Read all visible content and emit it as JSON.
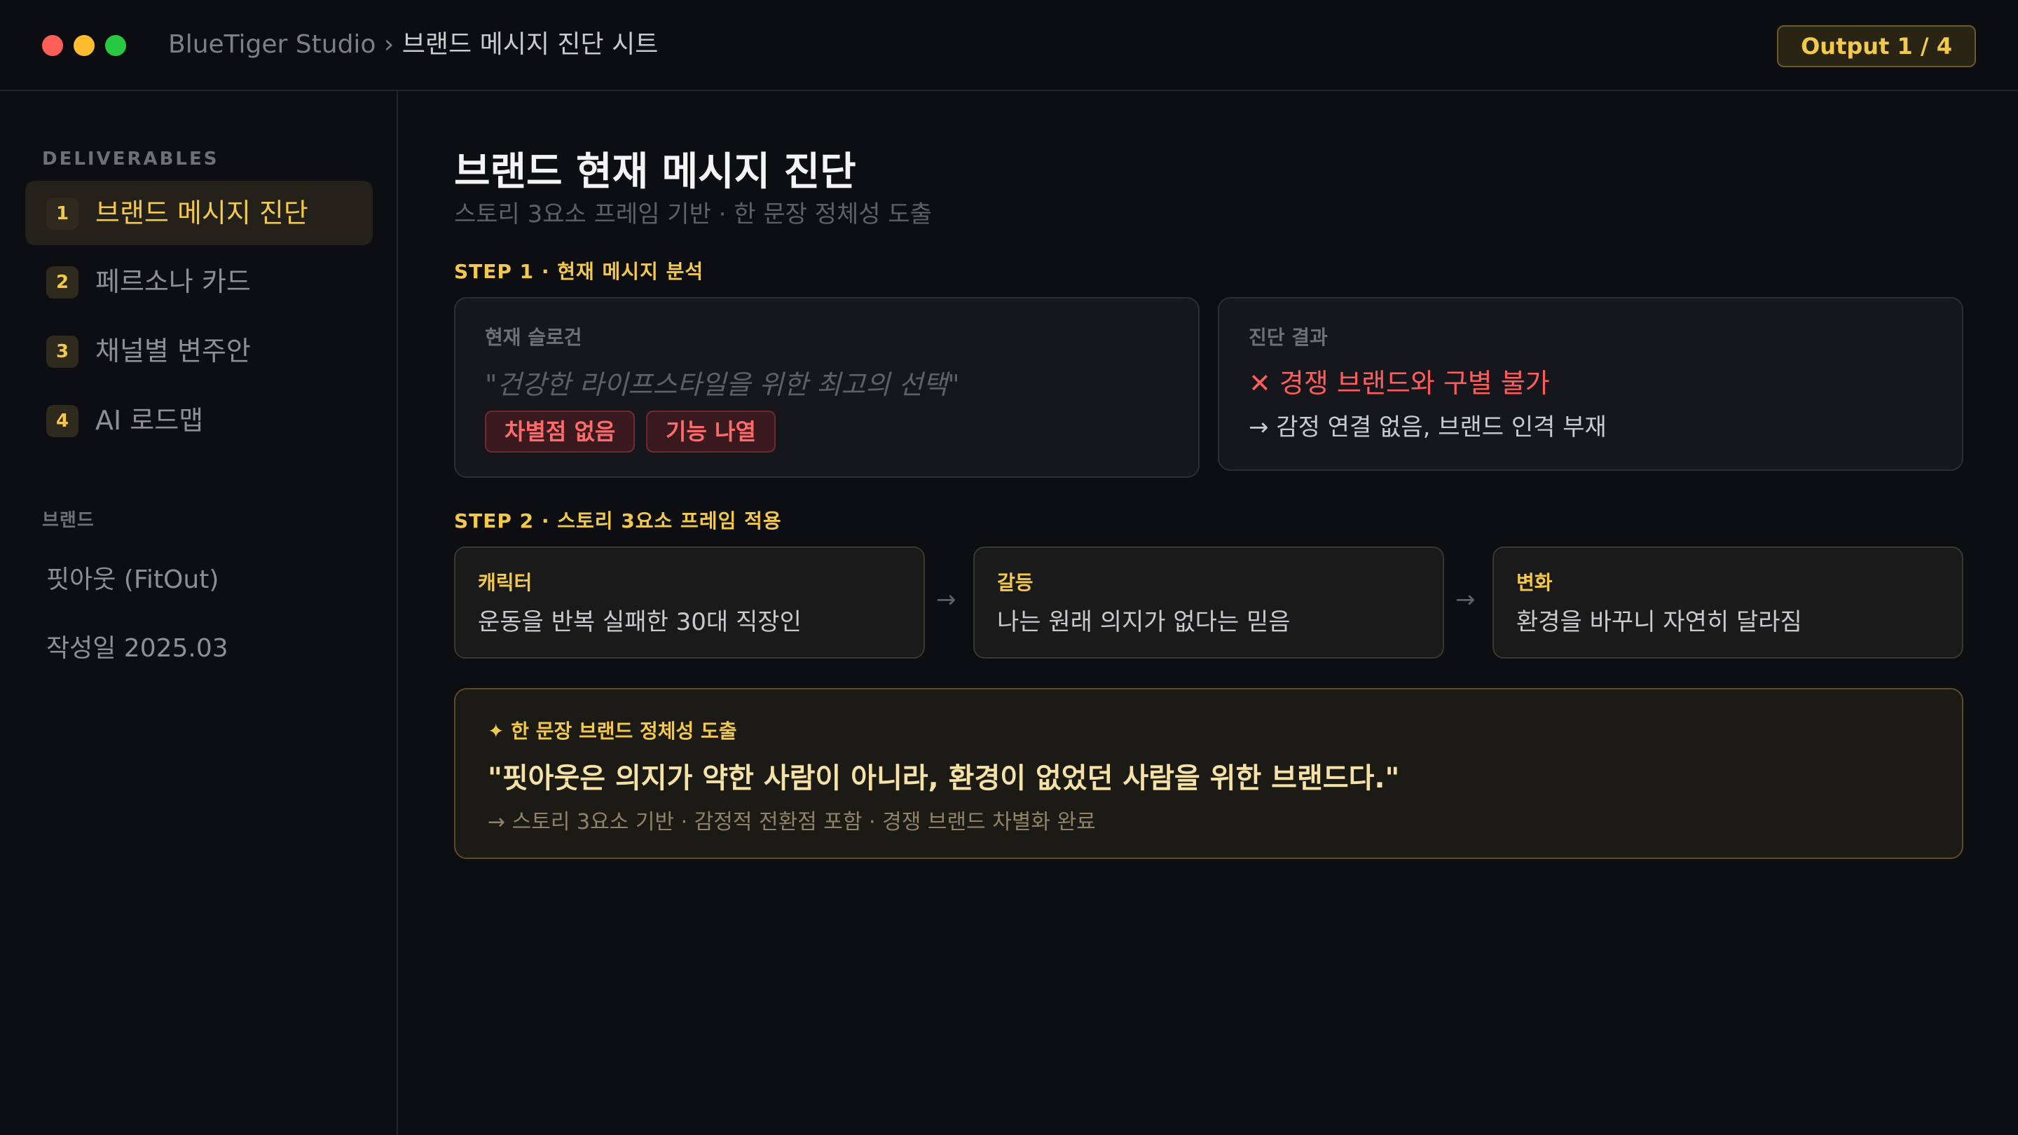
{
  "window": {
    "breadcrumb_root": "BlueTiger Studio",
    "breadcrumb_sep": "›",
    "breadcrumb_current": "브랜드 메시지 진단 시트",
    "output_badge": "Output 1 / 4"
  },
  "sidebar": {
    "section_label": "DELIVERABLES",
    "items": [
      {
        "num": "1",
        "label": "브랜드 메시지 진단"
      },
      {
        "num": "2",
        "label": "페르소나 카드"
      },
      {
        "num": "3",
        "label": "채널별 변주안"
      },
      {
        "num": "4",
        "label": "AI 로드맵"
      }
    ],
    "brand_label": "브랜드",
    "brand_name": "핏아웃 (FitOut)",
    "written_date": "작성일 2025.03"
  },
  "main": {
    "title": "브랜드 현재 메시지 진단",
    "subtitle": "스토리 3요소 프레임 기반 · 한 문장 정체성 도출",
    "step1": {
      "label": "STEP 1 · 현재 메시지 분석",
      "slogan_card": {
        "label": "현재 슬로건",
        "slogan": "\"건강한 라이프스타일을 위한 최고의 선택\"",
        "tags": [
          "차별점 없음",
          "기능 나열"
        ]
      },
      "result_card": {
        "label": "진단 결과",
        "verdict": "✕ 경쟁 브랜드와 구별 불가",
        "detail": "→ 감정 연결 없음, 브랜드 인격 부재"
      }
    },
    "step2": {
      "label": "STEP 2 · 스토리 3요소 프레임 적용",
      "arrow": "→",
      "frames": [
        {
          "key": "캐릭터",
          "value": "운동을 반복 실패한 30대 직장인"
        },
        {
          "key": "갈등",
          "value": "나는 원래 의지가 없다는 믿음"
        },
        {
          "key": "변화",
          "value": "환경을 바꾸니 자연히 달라짐"
        }
      ]
    },
    "identity": {
      "label": "✦ 한 문장 브랜드 정체성 도출",
      "quote": "\"핏아웃은 의지가 약한 사람이 아니라, 환경이 없었던 사람을 위한 브랜드다.\"",
      "note": "→ 스토리 3요소 기반 · 감정적 전환점 포함 · 경쟁 브랜드 차별화 완료"
    }
  }
}
